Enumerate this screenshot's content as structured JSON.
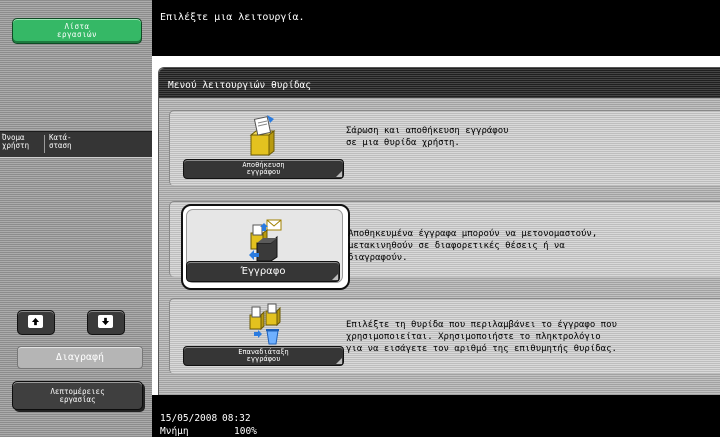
{
  "sidebar": {
    "job_list_label": "Λίστα\nεργασιών",
    "table_headers": [
      "Όνομα\nχρήστη",
      "Κατά-\nσταση"
    ],
    "delete_label": "Διαγραφή",
    "job_details_label": "Λεπτομέρειες\nεργασίας"
  },
  "header": {
    "instruction": "Επιλέξτε μια λειτουργία."
  },
  "panel": {
    "title": "Μενού λειτουργιών θυρίδας",
    "functions": [
      {
        "button_label": "Αποθήκευση\nεγγράφου",
        "description": "Σάρωση και αποθήκευση εγγράφου\nσε μια θυρίδα χρήστη.",
        "icon": "save-document-icon"
      },
      {
        "button_label": "Έγγραφο",
        "description": "Αποθηκευμένα έγγραφα μπορούν να μετονομαστούν,\nμετακινηθούν σε διαφορετικές θέσεις ή να\nδιαγραφούν.",
        "icon": "document-icon"
      },
      {
        "button_label": "Επαναδιάταξη\nεγγράφου",
        "description": "Επιλέξτε τη θυρίδα που περιλαμβάνει το έγγραφο που\nχρησιμοποιείται. Χρησιμοποιήστε το πληκτρολόγιο\nγια να εισάγετε τον αριθμό της επιθυμητής θυρίδας.",
        "icon": "rearrange-document-icon"
      }
    ]
  },
  "status": {
    "date": "15/05/2008",
    "time": "08:32",
    "memory_label": "Μνήμη",
    "memory_value": "100%"
  },
  "colors": {
    "job_list_button": "#35b866",
    "top_bar": "#000000",
    "function_button": "#363636"
  }
}
